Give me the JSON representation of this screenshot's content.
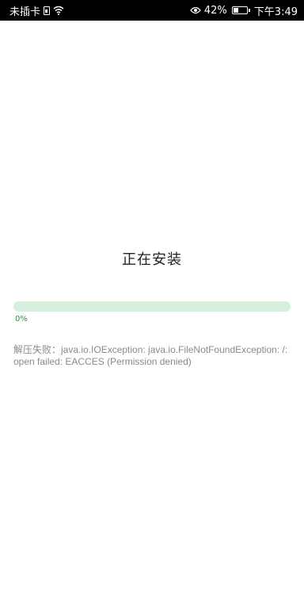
{
  "status_bar": {
    "carrier": "未插卡",
    "battery": "42%",
    "time": "下午3:49",
    "icons": [
      "sim-icon",
      "wifi-icon",
      "eye-icon",
      "battery-icon"
    ]
  },
  "install": {
    "title": "正在安装",
    "progress_percent": 0,
    "progress_label": "0%",
    "error_message": "解压失败：java.io.IOException: java.io.FileNotFoundException: /: open failed: EACCES (Permission denied)"
  },
  "colors": {
    "accent": "#3aa757",
    "progress_track": "#d6eedb",
    "status_bar_bg": "#000000"
  }
}
